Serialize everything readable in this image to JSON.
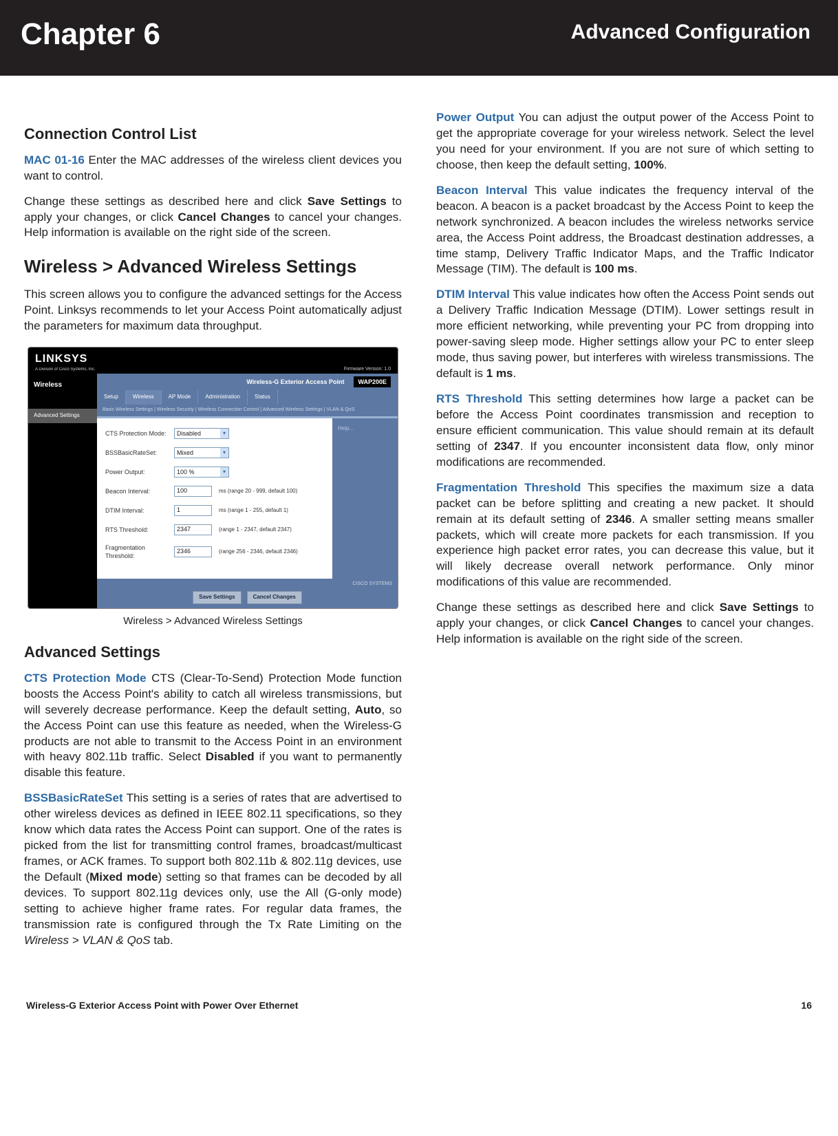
{
  "header": {
    "chapter": "Chapter 6",
    "section": "Advanced Configuration"
  },
  "left": {
    "h_ccl": "Connection Control List",
    "mac_lead": "MAC 01-16",
    "mac_text": "  Enter the MAC addresses of the wireless client devices you want to control.",
    "change1": "Change these settings as described here and click ",
    "save": "Save Settings",
    "change1b": " to apply your changes, or click ",
    "cancel": "Cancel Changes",
    "change1c": " to cancel your changes. Help information is available on the right side of the screen.",
    "h_aws": "Wireless > Advanced Wireless Settings",
    "aws_p": "This screen allows you to configure the advanced settings for the Access Point. Linksys recommends to let your Access Point automatically adjust the parameters for maximum data throughput.",
    "caption": "Wireless > Advanced Wireless Settings",
    "h_as": "Advanced Settings",
    "cts_lead": "CTS Protection Mode",
    "cts_text": " CTS (Clear-To-Send) Protection Mode function boosts the Access Point's ability to catch all wireless transmissions, but will severely decrease performance. Keep the default setting, ",
    "cts_auto": "Auto",
    "cts_text2": ", so the Access Point can use this feature as needed, when the Wireless-G products are not able to transmit to the Access Point in an environment with heavy 802.11b traffic. Select ",
    "cts_dis": "Disabled",
    "cts_text3": " if you want to permanently disable this feature.",
    "bss_lead": "BSSBasicRateSet",
    "bss_text": " This setting is a series of rates that are advertised to other wireless devices as defined in IEEE 802.11 specifications, so they know which data rates the Access Point can support. One of the rates is picked from the list for transmitting control frames, broadcast/multicast frames, or ACK frames. To support both 802.11b & 802.11g devices, use the Default (",
    "bss_mixed": "Mixed mode",
    "bss_text2": ") setting so that frames can be decoded by all devices. To support 802.11g devices only, use the All (G-only mode) setting to achieve higher frame rates. For regular data frames, the transmission rate is configured through the Tx Rate Limiting on the ",
    "bss_tab": "Wireless > VLAN & QoS",
    "bss_text3": " tab."
  },
  "right": {
    "po_lead": "Power Output",
    "po_text": "  You can adjust the output power of the Access Point to get the appropriate coverage for your wireless network. Select the level you need for your environment. If you are not sure of which setting to choose, then keep the default setting, ",
    "po_val": "100%",
    "po_text2": ".",
    "bi_lead": "Beacon Interval",
    "bi_text": " This value indicates the frequency interval of the beacon. A beacon is a packet broadcast by the Access Point to keep the network synchronized. A beacon includes the wireless networks service area, the Access Point address, the Broadcast destination addresses, a time stamp, Delivery Traffic Indicator Maps, and the Traffic Indicator Message (TIM). The default is ",
    "bi_val": "100 ms",
    "bi_text2": ".",
    "di_lead": "DTIM Interval",
    "di_text": "  This value indicates how often the Access Point sends out a Delivery Traffic Indication Message (DTIM). Lower settings result in more efficient networking, while preventing your PC from dropping into power-saving sleep mode. Higher settings allow your PC to enter sleep mode, thus saving power, but interferes with wireless transmissions. The default is ",
    "di_val": "1 ms",
    "di_text2": ".",
    "rts_lead": "RTS Threshold",
    "rts_text": "  This setting determines how large a packet can be before the Access Point coordinates transmission and reception to ensure efficient communication. This value should remain at its default setting of ",
    "rts_val": "2347",
    "rts_text2": ". If you encounter inconsistent data flow, only minor modifications are recommended.",
    "ft_lead": "Fragmentation Threshold",
    "ft_text": "  This specifies the maximum size a data packet can be before splitting and creating a new packet. It should remain at its default setting of ",
    "ft_val": "2346",
    "ft_text2": ". A smaller setting means smaller packets, which will create more packets for each transmission. If you experience high packet error rates, you can decrease this value, but it will likely decrease overall network performance. Only minor modifications of this value are recommended.",
    "change2": "Change these settings as described here and click ",
    "change2b": " to apply your changes, or click ",
    "change2c": " to cancel your changes. Help information is available on the right side of the screen."
  },
  "fig": {
    "logo": "LINKSYS",
    "sublogo": "A Division of Cisco Systems, Inc.",
    "fw": "Firmware Version: 1.0",
    "title": "Wireless-G Exterior Access Point",
    "model": "WAP200E",
    "side_main": "Wireless",
    "side_sub": "Advanced Settings",
    "tabs": {
      "t1": "Setup",
      "t2": "Wireless",
      "t3": "AP Mode",
      "t4": "Administration",
      "t5": "Status"
    },
    "subtabs": "Basic Wireless Settings  |  Wireless Security  |  Wireless Connection Control  |  Advanced Wireless Settings  |  VLAN & QoS",
    "rows": {
      "r1": {
        "lbl": "CTS Protection Mode:",
        "val": "Disabled"
      },
      "r2": {
        "lbl": "BSSBasicRateSet:",
        "val": "Mixed"
      },
      "r3": {
        "lbl": "Power Output:",
        "val": "100 %"
      },
      "r4": {
        "lbl": "Beacon Interval:",
        "val": "100",
        "hint": "ms (range 20 - 999, default 100)"
      },
      "r5": {
        "lbl": "DTIM Interval:",
        "val": "1",
        "hint": "ms (range 1 - 255, default 1)"
      },
      "r6": {
        "lbl": "RTS Threshold:",
        "val": "2347",
        "hint": "(range 1 - 2347, default 2347)"
      },
      "r7": {
        "lbl": "Fragmentation Threshold:",
        "val": "2346",
        "hint": "(range 256 - 2346, default 2346)"
      }
    },
    "help": "Help...",
    "btn_save": "Save Settings",
    "btn_cancel": "Cancel Changes",
    "cisco": "CISCO SYSTEMS"
  },
  "footer": {
    "left": "Wireless-G Exterior Access Point with Power Over Ethernet",
    "right": "16"
  }
}
